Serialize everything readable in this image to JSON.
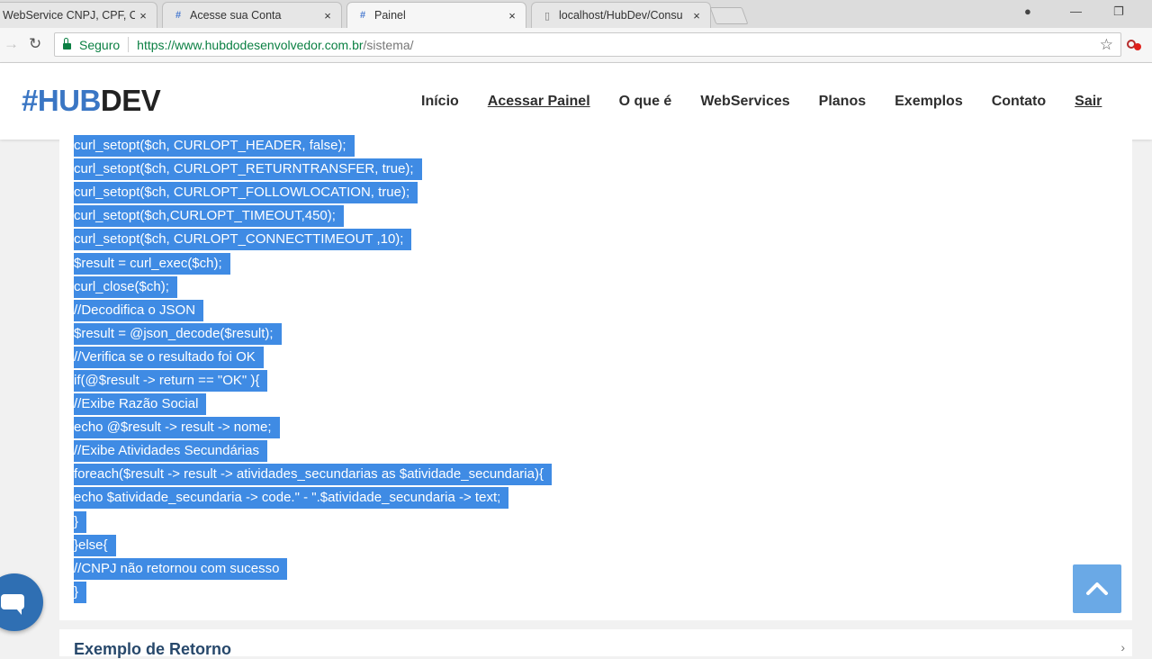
{
  "browser": {
    "tabs": [
      {
        "title": "WebService CNPJ, CPF, CE",
        "icon": "page-icon"
      },
      {
        "title": "Acesse sua Conta",
        "icon": "hashtag-icon"
      },
      {
        "title": "Painel",
        "icon": "hashtag-icon"
      },
      {
        "title": "localhost/HubDev/Consu",
        "icon": "page-icon"
      }
    ],
    "close_glyph": "×",
    "address": {
      "secure_label": "Seguro",
      "url_main": "https://www.hubdodesenvolvedor.com.br",
      "url_path": "/sistema/"
    }
  },
  "site": {
    "logo_hub": "#HUB",
    "logo_dev": "DEV",
    "nav": [
      "Início",
      "Acessar Painel",
      "O que é",
      "WebServices",
      "Planos",
      "Exemplos",
      "Contato",
      "Sair"
    ]
  },
  "code_lines": [
    "curl_setopt($ch, CURLOPT_HEADER, false);",
    "curl_setopt($ch, CURLOPT_RETURNTRANSFER, true);",
    "curl_setopt($ch, CURLOPT_FOLLOWLOCATION, true);",
    "curl_setopt($ch,CURLOPT_TIMEOUT,450);",
    "curl_setopt($ch, CURLOPT_CONNECTTIMEOUT ,10);",
    "$result = curl_exec($ch);",
    "curl_close($ch);",
    "//Decodifica o JSON",
    "$result = @json_decode($result);",
    "//Verifica se o resultado foi OK",
    "if(@$result -> return == \"OK\" ){",
    "//Exibe Razão Social",
    "echo @$result -> result -> nome;",
    "//Exibe Atividades Secundárias",
    "foreach($result -> result -> atividades_secundarias as $atividade_secundaria){",
    "echo $atividade_secundaria -> code.\" - \".$atividade_secundaria -> text;",
    "}",
    "}else{",
    "//CNPJ não retornou com sucesso",
    "}"
  ],
  "next_section": {
    "heading": "Exemplo de Retorno"
  },
  "colors": {
    "selection": "#3f8be4",
    "brand_blue": "#3a76c4",
    "scroll_button": "#6aa9e6"
  }
}
